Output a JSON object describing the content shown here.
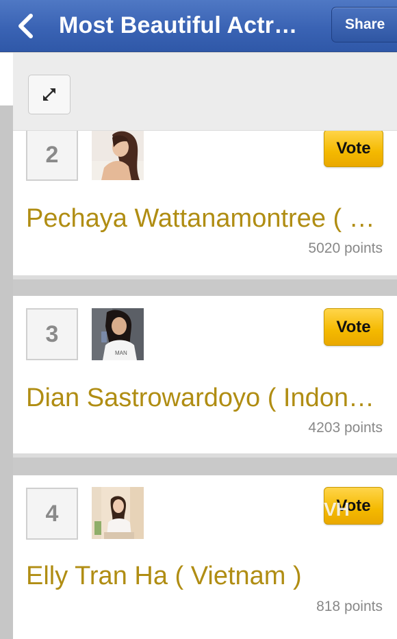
{
  "nav": {
    "title": "Most Beautiful Actr…",
    "back_icon": "chevron-left-icon",
    "share_label": "Share"
  },
  "toolbar": {
    "expand_icon": "expand-arrows-icon"
  },
  "colors": {
    "nav_blue": "#3a63b4",
    "vote_yellow": "#f4b900",
    "name_gold": "#b08d13",
    "points_gray": "#888888"
  },
  "entries": [
    {
      "rank": "2",
      "name": "Pechaya Wattanamontree ( …",
      "points": "5020 points",
      "vote_label": "Vote"
    },
    {
      "rank": "3",
      "name": "Dian Sastrowardoyo ( Indon…",
      "points": "4203 points",
      "vote_label": "Vote"
    },
    {
      "rank": "4",
      "name": "Elly Tran Ha ( Vietnam )",
      "points": "818 points",
      "vote_label": "Vote"
    }
  ],
  "watermark": "VH"
}
